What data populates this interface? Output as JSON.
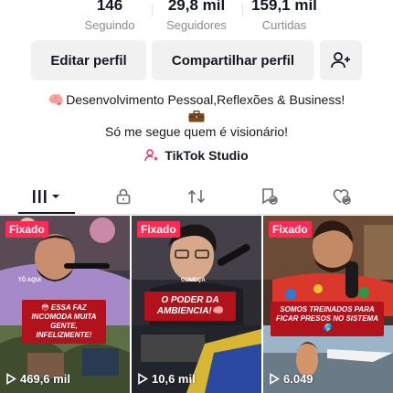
{
  "stats": [
    {
      "value": "146",
      "label": "Seguindo"
    },
    {
      "value": "29,8 mil",
      "label": "Seguidores"
    },
    {
      "value": "159,1 mil",
      "label": "Curtidas"
    }
  ],
  "actions": {
    "edit_label": "Editar perfil",
    "share_label": "Compartilhar perfil",
    "add_friend_icon": "person-plus-icon"
  },
  "bio": {
    "line1_emoji": "🧠",
    "line1": "Desenvolvimento Pessoal,Reflexões & Business!",
    "line2": "Só me segue quem é visionário!"
  },
  "studio": {
    "label": "TikTok Studio"
  },
  "tabs": [
    {
      "icon": "videos-grid-icon",
      "active": true
    },
    {
      "icon": "lock-icon",
      "active": false
    },
    {
      "icon": "repost-icon",
      "active": false
    },
    {
      "icon": "saved-hidden-icon",
      "active": false
    },
    {
      "icon": "liked-hidden-icon",
      "active": false
    }
  ],
  "videos": [
    {
      "badge": "Fixado",
      "views": "469,6 mil",
      "caption": "😳 ESSA FAZ INCOMODA MUITA GENTE, INFELIZMENTE!",
      "tag": "TÔ AQUI"
    },
    {
      "badge": "Fixado",
      "views": "10,6 mil",
      "caption": "O PODER DA AMBIENCIA!🧠",
      "tag": "COMEÇA"
    },
    {
      "badge": "Fixado",
      "views": "6.049",
      "caption": "SOMOS TREINADOS PARA FICAR PRESOS NO SISTEMA🌎",
      "tag": ""
    }
  ],
  "colors": {
    "accent": "#fe2c55",
    "caption_red": "#b3121c",
    "text": "#161823",
    "muted": "#8a8b91"
  }
}
